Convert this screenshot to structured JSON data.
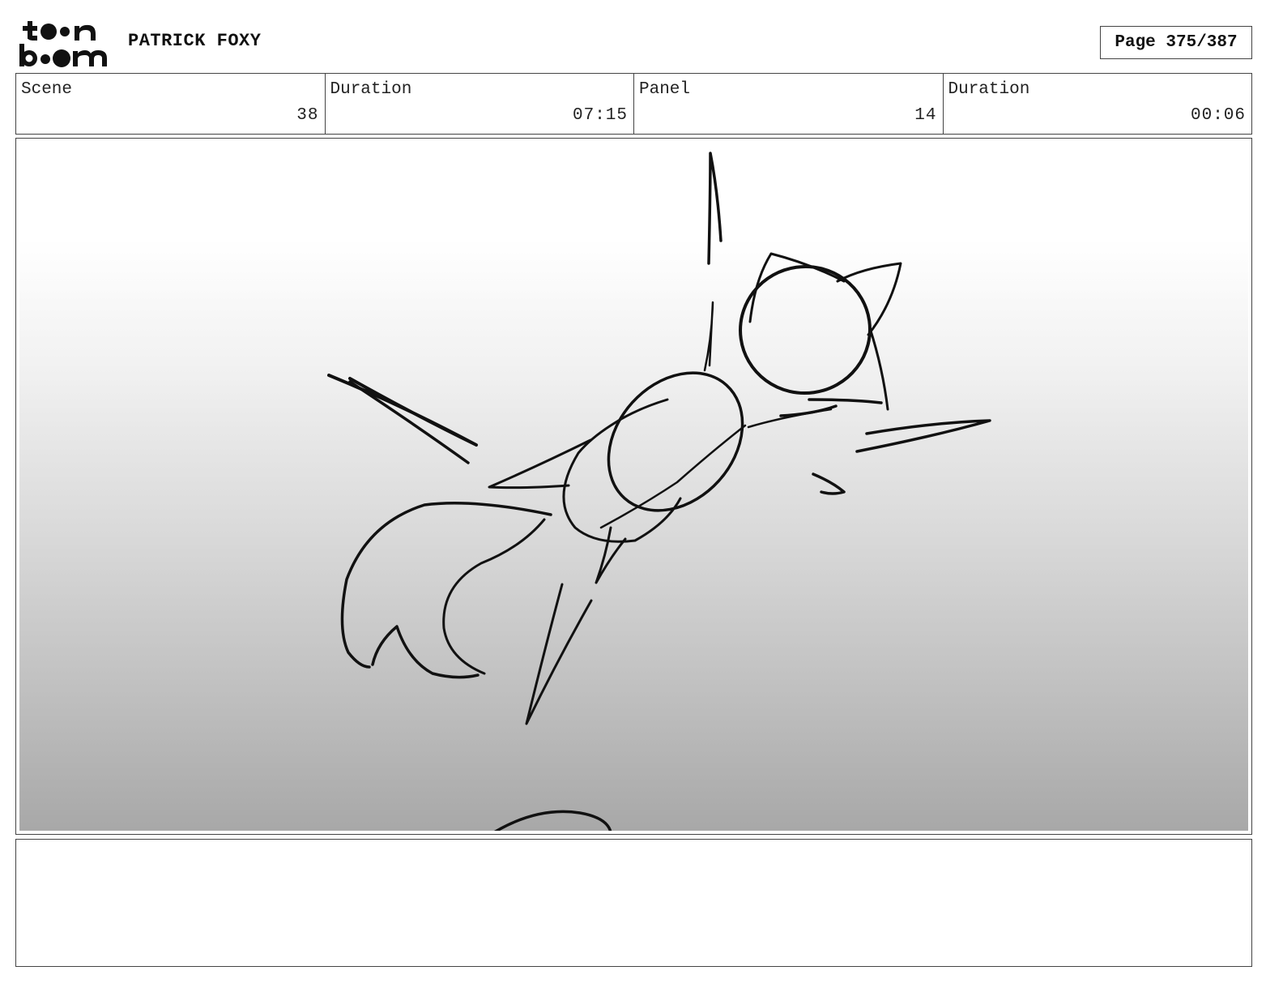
{
  "header": {
    "logo_text_top": "toon",
    "logo_text_bottom": "boom",
    "project_title": "PATRICK FOXY",
    "page_label": "Page 375/387"
  },
  "info": {
    "scene_label": "Scene",
    "scene_value": "38",
    "scene_duration_label": "Duration",
    "scene_duration_value": "07:15",
    "panel_label": "Panel",
    "panel_value": "14",
    "panel_duration_label": "Duration",
    "panel_duration_value": "00:06"
  },
  "panel": {
    "image_content": "rough pencil sketch of a fox character leaping",
    "gradient_top": "#ffffff",
    "gradient_bottom": "#a8a8a8"
  },
  "notes": {
    "text": ""
  }
}
